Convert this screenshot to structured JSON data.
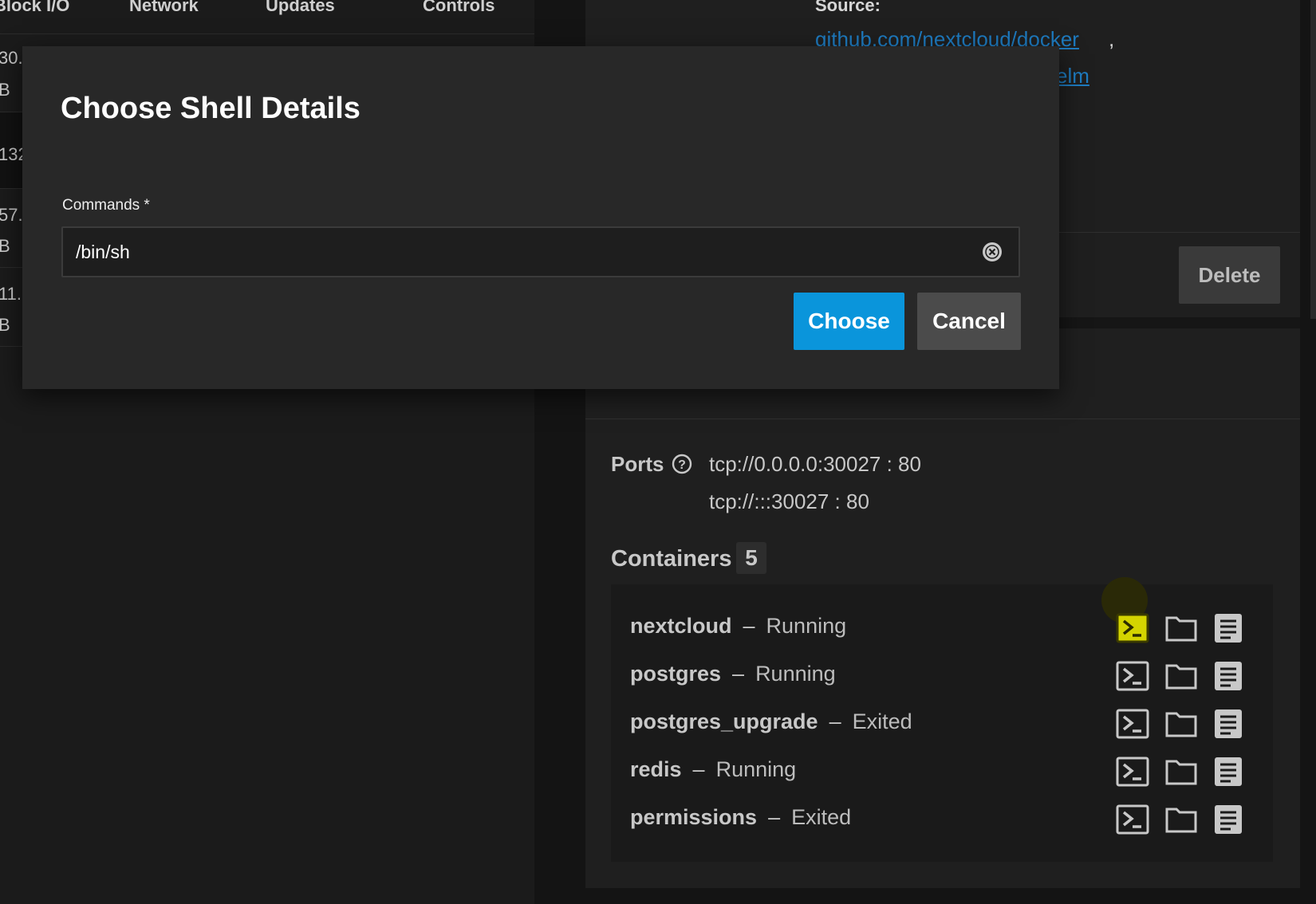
{
  "left_table": {
    "headers": [
      "Block I/O",
      "Network",
      "Updates",
      "Controls"
    ],
    "rows": [
      {
        "line1": "30.",
        "line2": "B"
      },
      {
        "line1": "132",
        "line2": ""
      },
      {
        "line1": "57.",
        "line2": "B"
      },
      {
        "line1": "11.",
        "line2": "B"
      }
    ]
  },
  "app_info": {
    "source_label": "Source:",
    "source_links": [
      "github.com/nextcloud/docker",
      "elm"
    ],
    "source_separator": ",",
    "delete_label": "Delete"
  },
  "ports": {
    "label": "Ports",
    "help_icon": "question-circle-icon",
    "values": [
      "tcp://0.0.0.0:30027 : 80",
      "tcp://:::30027 : 80"
    ]
  },
  "containers": {
    "label": "Containers",
    "count": "5",
    "separator": "–",
    "icons": [
      "terminal-icon",
      "folder-icon",
      "logs-icon"
    ],
    "items": [
      {
        "name": "nextcloud",
        "state": "Running"
      },
      {
        "name": "postgres",
        "state": "Running"
      },
      {
        "name": "postgres_upgrade",
        "state": "Exited"
      },
      {
        "name": "redis",
        "state": "Running"
      },
      {
        "name": "permissions",
        "state": "Exited"
      }
    ]
  },
  "modal": {
    "title": "Choose Shell Details",
    "field_label": "Commands *",
    "field_value": "/bin/sh",
    "clear_icon": "clear-circle-icon",
    "choose_label": "Choose",
    "cancel_label": "Cancel"
  },
  "colors": {
    "accent": "#0a95db",
    "link": "#1e7bc0",
    "terminal_highlight": "#d4d400"
  }
}
